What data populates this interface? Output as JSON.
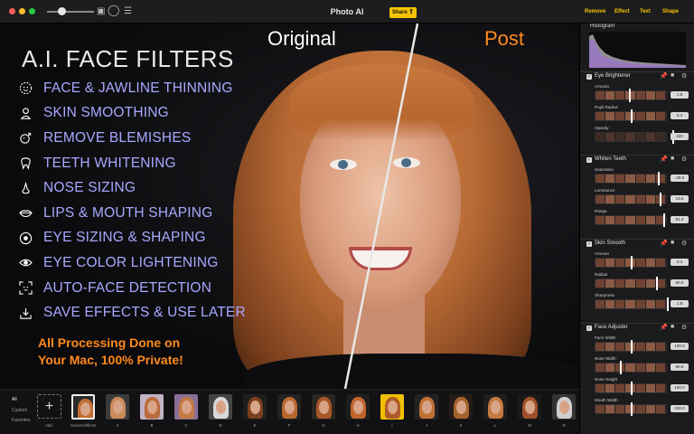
{
  "titlebar": {
    "app_title": "Photo AI",
    "share_label": "Share",
    "tabs": [
      "Remove",
      "Effect",
      "Text",
      "Shape"
    ]
  },
  "canvas": {
    "label_original": "Original",
    "label_post": "Post",
    "headline": "A.I. FACE FILTERS",
    "features": [
      {
        "label": "FACE & JAWLINE THINNING",
        "icon": "face-outline-icon"
      },
      {
        "label": "SKIN SMOOTHING",
        "icon": "person-icon"
      },
      {
        "label": "REMOVE BLEMISHES",
        "icon": "blemish-icon"
      },
      {
        "label": "TEETH WHITENING",
        "icon": "tooth-icon"
      },
      {
        "label": "NOSE SIZING",
        "icon": "nose-icon"
      },
      {
        "label": "LIPS & MOUTH SHAPING",
        "icon": "lips-icon"
      },
      {
        "label": "EYE SIZING & SHAPING",
        "icon": "eye-target-icon"
      },
      {
        "label": "EYE COLOR LIGHTENING",
        "icon": "eye-icon"
      },
      {
        "label": "AUTO-FACE DETECTION",
        "icon": "face-detect-icon"
      },
      {
        "label": "SAVE EFFECTS & USE LATER",
        "icon": "download-icon"
      }
    ],
    "tagline_line1": "All Processing Done on",
    "tagline_line2": "Your Mac, 100% Private!",
    "colors": {
      "feature": "#a7a8ff",
      "accent": "#ff8a1e"
    }
  },
  "panel": {
    "histogram_title": "Histogram",
    "sections": [
      {
        "title": "Eye Brightener",
        "params": [
          {
            "label": "Amount",
            "value": "1.8"
          },
          {
            "label": "Pupil Radius",
            "value": "0.4"
          },
          {
            "label": "Opacity",
            "value": "100"
          }
        ]
      },
      {
        "title": "Whiten Teeth",
        "params": [
          {
            "label": "Saturation",
            "value": "-29.9"
          },
          {
            "label": "Luminance",
            "value": "13.6"
          },
          {
            "label": "Range",
            "value": "51.4"
          }
        ]
      },
      {
        "title": "Skin Smooth",
        "params": [
          {
            "label": "Amount",
            "value": "0.3"
          },
          {
            "label": "Radius",
            "value": "90.0"
          },
          {
            "label": "Sharpness",
            "value": "1.8"
          }
        ]
      },
      {
        "title": "Face Adjuster",
        "params": [
          {
            "label": "Face Width",
            "value": "100.0"
          },
          {
            "label": "Nose Width",
            "value": "90.8"
          },
          {
            "label": "Nose Height",
            "value": "100.0"
          },
          {
            "label": "Mouth Width",
            "value": "100.0"
          }
        ]
      }
    ]
  },
  "bottom": {
    "categories": [
      "All",
      "Custom",
      "Favorites"
    ],
    "add_label": "Add",
    "add_symbol": "+",
    "thumbs": [
      "Current Effects",
      "A",
      "B",
      "C",
      "D",
      "E",
      "F",
      "G",
      "H",
      "I",
      "J",
      "K",
      "L",
      "M",
      "N"
    ]
  }
}
